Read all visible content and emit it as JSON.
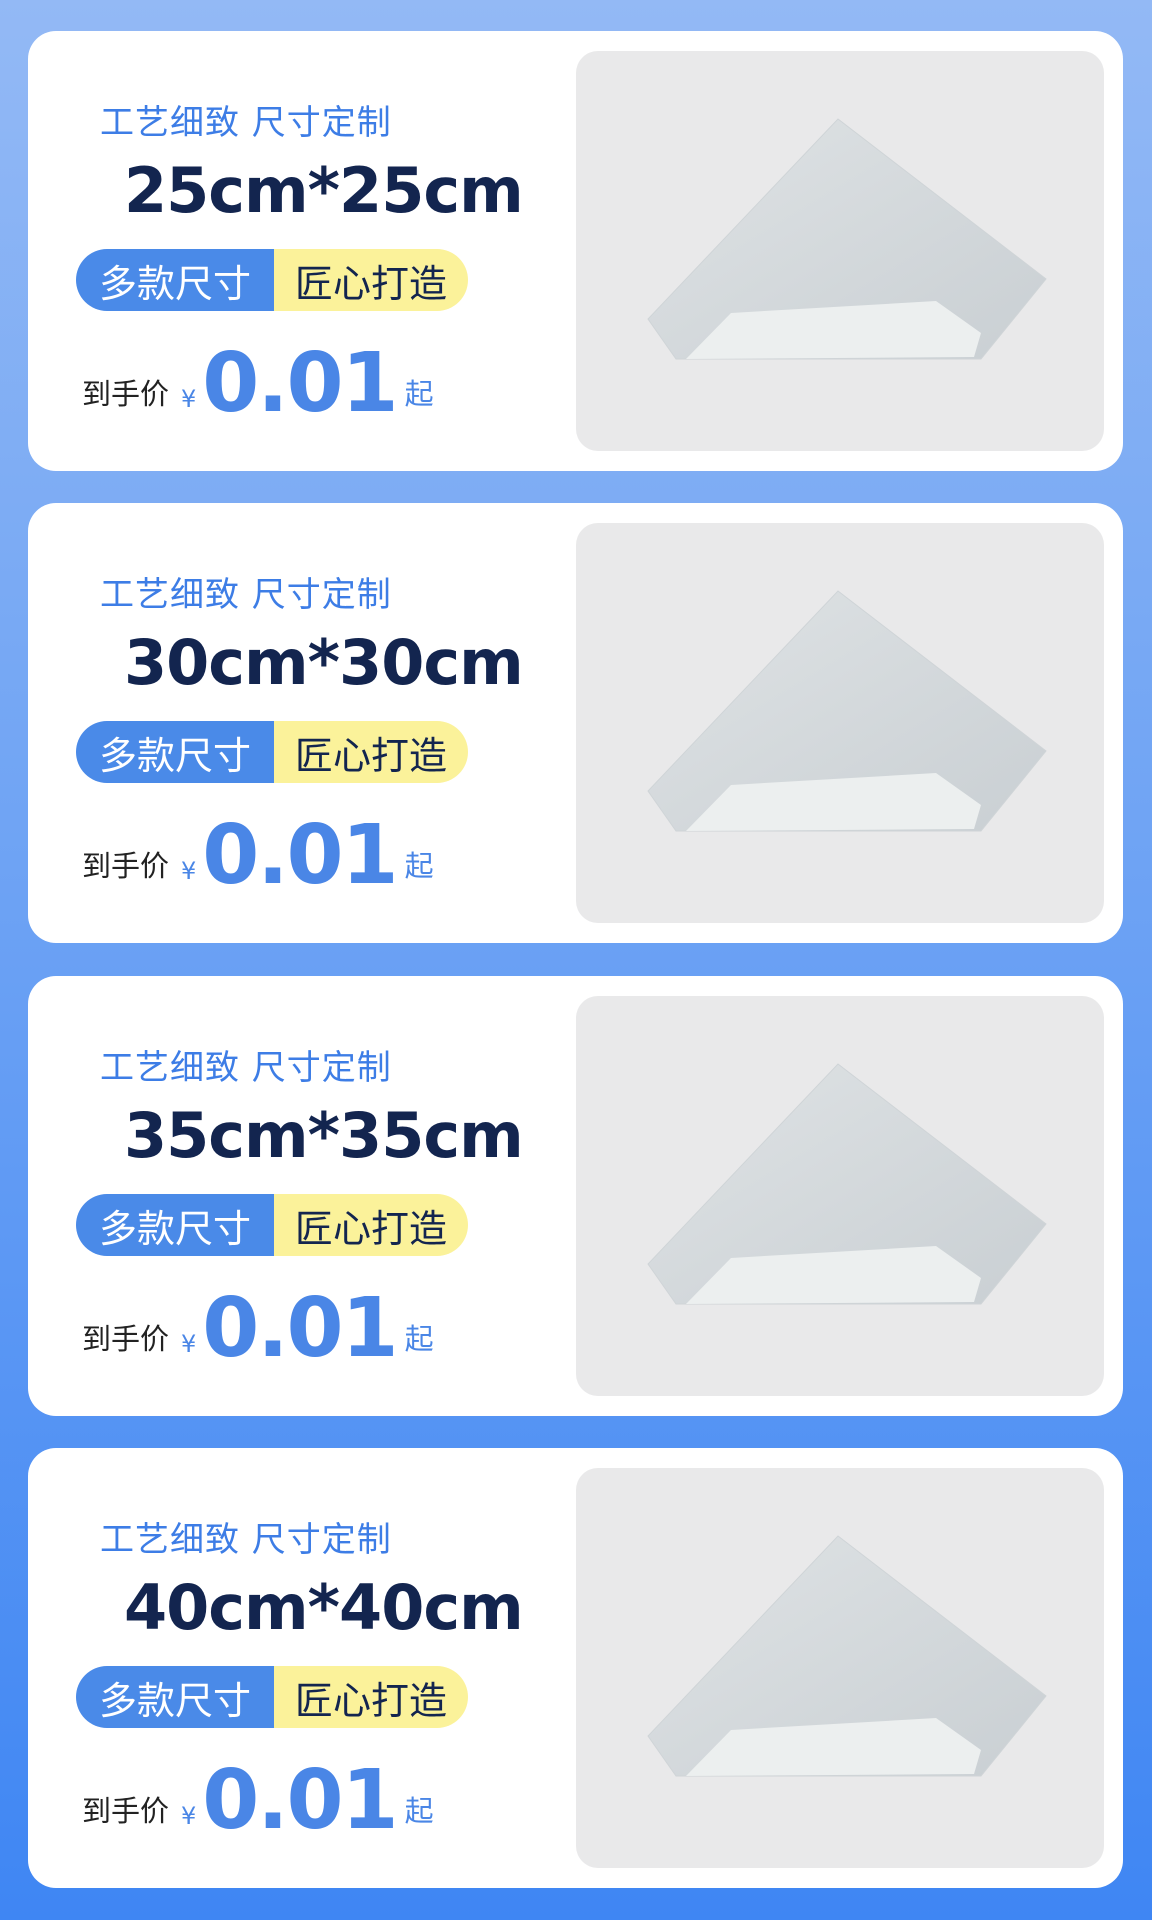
{
  "cards": [
    {
      "tagline": "工艺细致 尺寸定制",
      "size": "25cm*25cm",
      "badge_left": "多款尺寸",
      "badge_right": "匠心打造",
      "price_label": "到手价",
      "currency": "¥",
      "price": "0.01",
      "price_suffix": "起"
    },
    {
      "tagline": "工艺细致 尺寸定制",
      "size": "30cm*30cm",
      "badge_left": "多款尺寸",
      "badge_right": "匠心打造",
      "price_label": "到手价",
      "currency": "¥",
      "price": "0.01",
      "price_suffix": "起"
    },
    {
      "tagline": "工艺细致 尺寸定制",
      "size": "35cm*35cm",
      "badge_left": "多款尺寸",
      "badge_right": "匠心打造",
      "price_label": "到手价",
      "currency": "¥",
      "price": "0.01",
      "price_suffix": "起"
    },
    {
      "tagline": "工艺细致 尺寸定制",
      "size": "40cm*40cm",
      "badge_left": "多款尺寸",
      "badge_right": "匠心打造",
      "price_label": "到手价",
      "currency": "¥",
      "price": "0.01",
      "price_suffix": "起"
    }
  ],
  "colors": {
    "background_top": "#93b9f5",
    "background_bottom": "#3f86f3",
    "accent_blue": "#4a86e6",
    "title_navy": "#13254f",
    "badge_yellow": "#fbf29a",
    "photo_background": "#e9e9ea"
  },
  "product_image": "folded-white-paper-sheet-photo"
}
